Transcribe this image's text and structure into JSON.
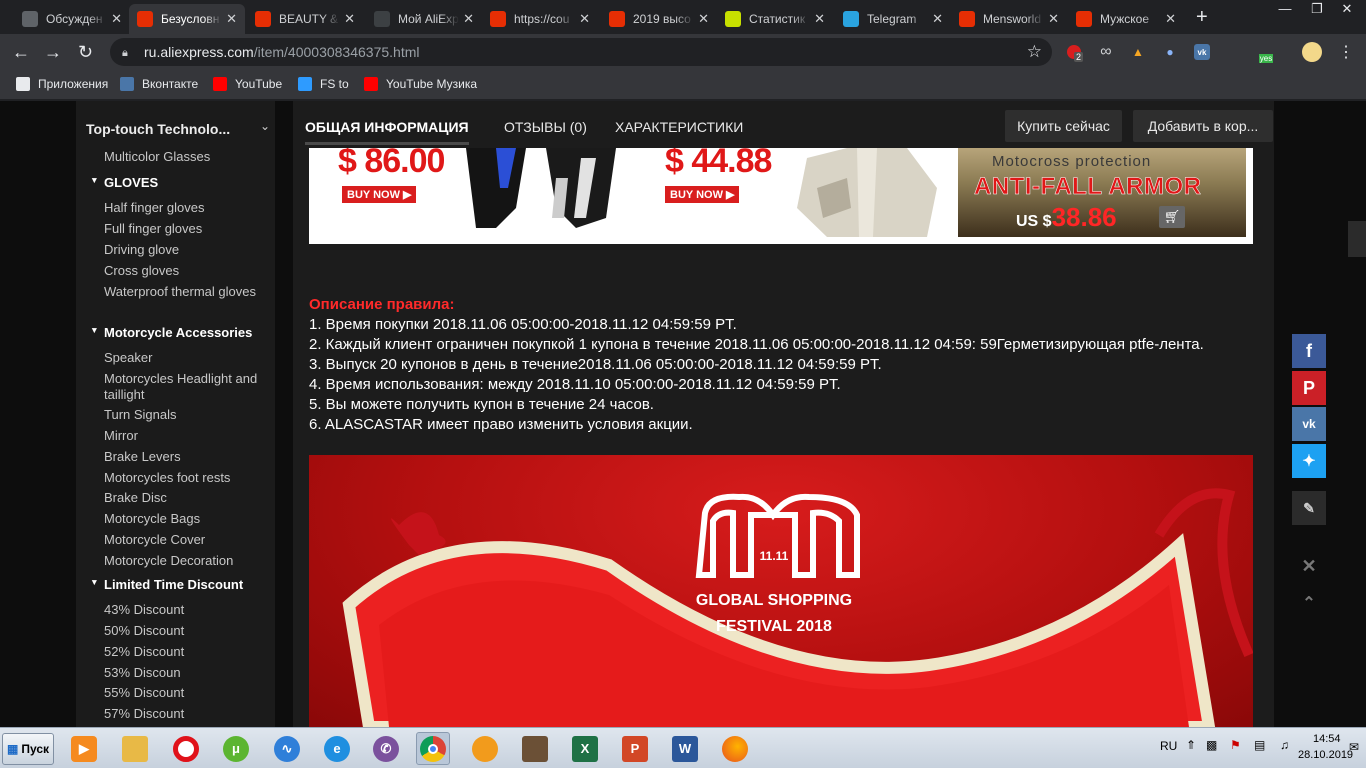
{
  "browser": {
    "tabs": [
      {
        "title": "Обсужден",
        "favicon_color": "#5f6368",
        "favicon": "chat-icon",
        "active": false
      },
      {
        "title": "Безусловн",
        "favicon_color": "#e62e04",
        "favicon": "aliexpress-icon",
        "active": true
      },
      {
        "title": "BEAUTY &",
        "favicon_color": "#e62e04",
        "favicon": "aliexpress-icon",
        "active": false
      },
      {
        "title": "Мой AliExp",
        "favicon_color": "#3c4043",
        "favicon": "globe-icon",
        "active": false
      },
      {
        "title": "https://cou",
        "favicon_color": "#e62e04",
        "favicon": "aliexpress-icon",
        "active": false
      },
      {
        "title": "2019 высо",
        "favicon_color": "#e62e04",
        "favicon": "aliexpress-icon",
        "active": false
      },
      {
        "title": "Статистик",
        "favicon_color": "#c7e000",
        "favicon": "stats-icon",
        "active": false
      },
      {
        "title": "Telegram",
        "favicon_color": "#2aa3df",
        "favicon": "telegram-icon",
        "active": false
      },
      {
        "title": "Mensworld",
        "favicon_color": "#e62e04",
        "favicon": "aliexpress-icon",
        "active": false
      },
      {
        "title": "Мужское",
        "favicon_color": "#e62e04",
        "favicon": "aliexpress-icon",
        "active": false
      }
    ],
    "new_tab": "+",
    "url": {
      "domain": "ru.aliexpress.com",
      "path": "/item/4000308346375.html"
    },
    "ext_badge": "2",
    "ext_yes": "yes",
    "bookmarks": [
      {
        "label": "Приложения",
        "icon": "apps-grid-icon",
        "color": "#e8eaed"
      },
      {
        "label": "Вконтакте",
        "icon": "vk-icon",
        "color": "#4a76a8"
      },
      {
        "label": "YouTube",
        "icon": "youtube-icon",
        "color": "#ff0000"
      },
      {
        "label": "FS to",
        "icon": "fs-arrow-icon",
        "color": "#2e9bff"
      },
      {
        "label": "YouTube Музика",
        "icon": "youtube-music-icon",
        "color": "#ff0000"
      }
    ]
  },
  "sidebar": {
    "store_name": "Top-touch Technolo...",
    "items": [
      {
        "type": "item",
        "label": "Multicolor Glasses"
      },
      {
        "type": "cat",
        "label": "GLOVES"
      },
      {
        "type": "item",
        "label": "Half finger gloves"
      },
      {
        "type": "item",
        "label": "Full finger gloves"
      },
      {
        "type": "item",
        "label": "Driving glove"
      },
      {
        "type": "item",
        "label": "Cross gloves"
      },
      {
        "type": "item",
        "label": "Waterproof thermal gloves"
      },
      {
        "type": "cat",
        "label": "Motorcycle Accessories"
      },
      {
        "type": "item",
        "label": "Speaker"
      },
      {
        "type": "item",
        "label": "Motorcycles Headlight and taillight"
      },
      {
        "type": "item",
        "label": "Turn Signals"
      },
      {
        "type": "item",
        "label": "Mirror"
      },
      {
        "type": "item",
        "label": "Brake Levers"
      },
      {
        "type": "item",
        "label": "Motorcycles foot rests"
      },
      {
        "type": "item",
        "label": "Brake Disc"
      },
      {
        "type": "item",
        "label": "Motorcycle Bags"
      },
      {
        "type": "item",
        "label": "Motorcycle Cover"
      },
      {
        "type": "item",
        "label": "Motorcycle Decoration"
      },
      {
        "type": "cat",
        "label": "Limited Time Discount"
      },
      {
        "type": "item",
        "label": "43% Discount"
      },
      {
        "type": "item",
        "label": "50% Discount"
      },
      {
        "type": "item",
        "label": "52% Discount"
      },
      {
        "type": "item",
        "label": "53% Discoun"
      },
      {
        "type": "item",
        "label": "55% Discount"
      },
      {
        "type": "item",
        "label": "57% Discount"
      }
    ]
  },
  "product_tabs": {
    "general": "ОБЩАЯ ИНФОРМАЦИЯ",
    "reviews": "ОТЗЫВЫ (0)",
    "specs": "ХАРАКТЕРИСТИКИ",
    "buy_now": "Купить сейчас",
    "add_to_cart": "Добавить в кор..."
  },
  "banner": {
    "price1": "$ 86.00",
    "price2": "$ 44.88",
    "buy_now": "BUY NOW",
    "promo_line1": "Motocross protection",
    "promo_line2": "ANTI-FALL ARMOR",
    "promo_currency": "US $",
    "promo_price": "38.86"
  },
  "rules": {
    "heading": "Описание правила:",
    "lines": [
      "1. Время покупки 2018.11.06 05:00:00-2018.11.12 04:59:59 PT.",
      "2. Каждый клиент ограничен покупкой 1 купона в течение 2018.11.06 05:00:00-2018.11.12 04:59: 59Герметизирующая ptfe-лента.",
      "3. Выпуск 20 купонов в день в течение2018.11.06 05:00:00-2018.11.12 04:59:59 PT.",
      "4. Время использования: между 2018.11.10 05:00:00-2018.11.12 04:59:59 PT.",
      "5. Вы можете получить купон в течение 24 часов.",
      "6. ALASCASTAR имеет право изменить условия акции."
    ]
  },
  "festival": {
    "logo_text": "11.11",
    "line1": "GLOBAL SHOPPING",
    "line2": "FESTIVAL 2018"
  },
  "taskbar": {
    "start": "Пуск",
    "lang": "RU",
    "time": "14:54",
    "date": "28.10.2019"
  }
}
